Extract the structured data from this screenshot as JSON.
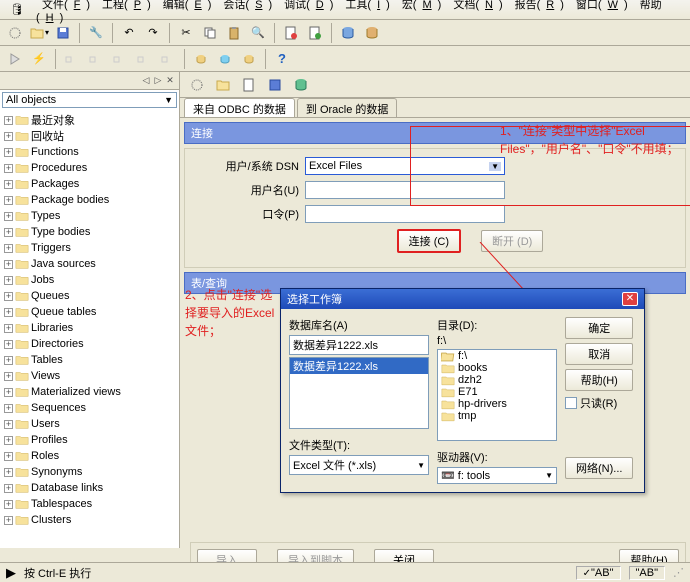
{
  "menu": [
    "文件(F)",
    "工程(P)",
    "编辑(E)",
    "会话(S)",
    "调试(D)",
    "工具(I)",
    "宏(M)",
    "文档(N)",
    "报告(R)",
    "窗口(W)",
    "帮助(H)"
  ],
  "object_selector": "All objects",
  "tree": [
    "最近对象",
    "回收站",
    "Functions",
    "Procedures",
    "Packages",
    "Package bodies",
    "Types",
    "Type bodies",
    "Triggers",
    "Java sources",
    "Jobs",
    "Queues",
    "Queue tables",
    "Libraries",
    "Directories",
    "Tables",
    "Views",
    "Materialized views",
    "Sequences",
    "Users",
    "Profiles",
    "Roles",
    "Synonyms",
    "Database links",
    "Tablespaces",
    "Clusters"
  ],
  "tabs": {
    "active": "来自 ODBC 的数据",
    "inactive": "到 Oracle 的数据"
  },
  "section_connect": "连接",
  "form": {
    "dsn_label": "用户/系统 DSN",
    "dsn_value": "Excel Files",
    "user_label": "用户名(U)",
    "user_value": "",
    "pwd_label": "口令(P)",
    "pwd_value": "",
    "connect_btn": "连接 (C)",
    "disconnect_btn": "断开 (D)"
  },
  "section_query": "表/查询",
  "annot1": "1、\"连接\"类型中选择\"Excel Files\"，\"用户名\"、\"口令\"不用填；",
  "annot2": "2、点击\"连接\"选择要导入的Excel文件；",
  "dialog": {
    "title": "选择工作簿",
    "dbname_label": "数据库名(A)",
    "dbname_value": "数据差异1222.xls",
    "list_selected": "数据差异1222.xls",
    "dir_label": "目录(D):",
    "dir_path": "f:\\",
    "dirs": [
      "f:\\",
      "books",
      "dzh2",
      "E71",
      "hp-drivers",
      "tmp"
    ],
    "filetype_label": "文件类型(T):",
    "filetype_value": "Excel 文件 (*.xls)",
    "drive_label": "驱动器(V):",
    "drive_value": "f: tools",
    "ok": "确定",
    "cancel": "取消",
    "help": "帮助(H)",
    "readonly": "只读(R)",
    "network": "网络(N)..."
  },
  "bottom": {
    "import": "导入",
    "toscript": "导入到脚本",
    "close": "关闭",
    "help": "帮助(H)"
  },
  "status": {
    "hint": "按 Ctrl-E 执行",
    "ab1": "\"AB\"",
    "ab2": "\"AB\""
  }
}
